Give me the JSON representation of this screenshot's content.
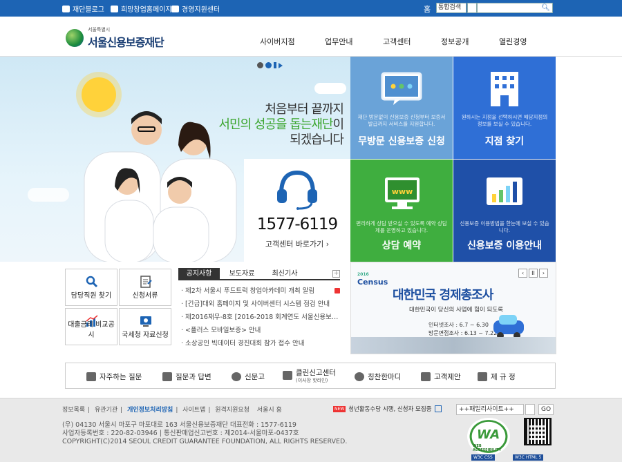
{
  "topbar": {
    "links": [
      "재단블로그",
      "희망창업홈페이지",
      "경영지원센터"
    ],
    "home_label": "홈",
    "search_scope": "통합검색",
    "search_placeholder": ""
  },
  "header": {
    "logo_small": "서울특별시",
    "logo_name": "서울신용보증재단",
    "nav": [
      "사이버지점",
      "업무안내",
      "고객센터",
      "정보공개",
      "열린경영"
    ]
  },
  "hero": {
    "slogan_line1": "처음부터 끝까지",
    "slogan_line2_green": "서민의 성공을 돕는재단",
    "slogan_line2_tail": "이",
    "slogan_line3": "되겠습니다",
    "phone": "1577-6119",
    "phone_link": "고객센터 바로가기 ›"
  },
  "tiles": [
    {
      "desc": "재단 방문없이 신용보증 신청부터 보증서 발급까지 서비스를 지원합니다.",
      "title": "무방문 신용보증 신청",
      "color": "#6aa3d8"
    },
    {
      "desc": "원하시는 지점을 선택하시면 해당지점의 정보를 보실 수 있습니다.",
      "title": "지점 찾기",
      "color": "#2f6fd6"
    },
    {
      "desc": "편리하게 상담 받으실 수 있도록 예약 상담제를 운영하고 있습니다.",
      "title": "상담 예약",
      "color": "#3fae3f"
    },
    {
      "desc": "신용보증 이용방법을 한눈에 보실 수 있습니다.",
      "title": "신용보증 이용안내",
      "color": "#1f50a8"
    }
  ],
  "quick_links": [
    "담당직원 찾기",
    "신청서류",
    "대출금리 비교공시",
    "국세청 자료신청"
  ],
  "news": {
    "tabs": [
      "공지사항",
      "보도자료",
      "최신기사"
    ],
    "more": "+",
    "items": [
      "제2차 서울시 푸드트럭 창업아카데미 개최 알림",
      "[긴급]대외 홈페이지 및 사이버센터 시스템 점검 안내",
      "제2016재무-8호 [2016-2018 회계연도 서울신용보…",
      "<플러스 모바일보증> 안내",
      "소상공인 빅데이터 경진대회 참가 접수 안내"
    ]
  },
  "banner": {
    "logo": "Census",
    "logo_year": "2016",
    "title": "대한민국 경제총조사",
    "subtitle": "대한민국이 당신의 사업에 힘이 되도록",
    "date1": "인터넷조사 : 6.7 ~ 6.30",
    "date2": "방문면접조사 : 6.13 ~ 7.22",
    "controls": [
      "‹",
      "II",
      "›"
    ]
  },
  "services": [
    {
      "label": "자주하는 질문",
      "sub": ""
    },
    {
      "label": "질문과 답변",
      "sub": ""
    },
    {
      "label": "신문고",
      "sub": ""
    },
    {
      "label": "클린신고센터",
      "sub": "(이사장 핫라인)"
    },
    {
      "label": "칭찬한마디",
      "sub": ""
    },
    {
      "label": "고객제안",
      "sub": ""
    },
    {
      "label": "제 규 정",
      "sub": ""
    }
  ],
  "footer": {
    "links": [
      "정보목록",
      "유관기관",
      "개인정보처리방침",
      "사이트맵",
      "원격지원요청",
      "서울시 홈"
    ],
    "notice_badge": "NEW",
    "notice": "청년활동수당 시행, 신청자 모집중",
    "family_site": "++패밀리사이트++",
    "go": "GO",
    "address1": "(우) 04130 서울시 마포구 마포대로 163 서울신용보증재단 대표전화 : 1577-6119",
    "address2": "사업자등록번호 : 220-82-03946 | 통신판매업신고번호 : 제2014-서울마포-0437호",
    "copyright": "COPYRIGHT(C)2014 SEOUL CREDIT GUARANTEE FOUNDATION, ALL RIGHTS RESERVED.",
    "wa_mark": "WA",
    "wa_text": "WEB ACCESSIBILITY",
    "w3c1": "W3C CSS",
    "w3c2": "W3C HTML 5"
  }
}
